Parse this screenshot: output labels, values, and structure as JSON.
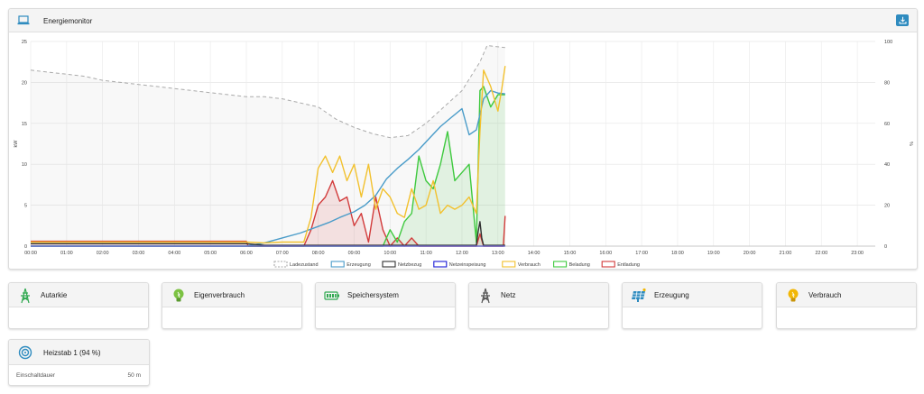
{
  "energy_card": {
    "title": "Energiemonitor",
    "title_icon": "laptop-icon",
    "action_icon": "download-icon"
  },
  "tiles": [
    {
      "name": "autarkie",
      "title": "Autarkie",
      "icon": "power-tower-icon",
      "icon_color": "#2fa84f"
    },
    {
      "name": "eigenverbrauch",
      "title": "Eigenverbrauch",
      "icon": "lightbulb-icon",
      "icon_color": "#7cc243"
    },
    {
      "name": "speichersystem",
      "title": "Speichersystem",
      "icon": "battery-icon",
      "icon_color": "#2fa84f"
    },
    {
      "name": "netz",
      "title": "Netz",
      "icon": "power-tower-icon",
      "icon_color": "#555555"
    },
    {
      "name": "erzeugung",
      "title": "Erzeugung",
      "icon": "solar-panel-icon",
      "icon_color": "#2e8bbf"
    },
    {
      "name": "verbrauch",
      "title": "Verbrauch",
      "icon": "lightbulb-icon",
      "icon_color": "#f2b705"
    }
  ],
  "heizstab": {
    "title": "Heizstab 1 (94 %)",
    "icon": "heater-icon",
    "row_label": "Einschaltdauer",
    "row_value": "50 m"
  },
  "chart_data": {
    "type": "line",
    "ylabel_left": "kW",
    "ylabel_right": "%",
    "ylim_left": [
      0,
      25
    ],
    "ylim_right": [
      0,
      100
    ],
    "y_ticks_left": [
      "0",
      "5",
      "10",
      "15",
      "20",
      "25"
    ],
    "y_ticks_right": [
      "0",
      "20",
      "40",
      "60",
      "80",
      "100"
    ],
    "x_ticks": [
      "00:00",
      "01:00",
      "02:00",
      "03:00",
      "04:00",
      "05:00",
      "06:00",
      "07:00",
      "08:00",
      "09:00",
      "10:00",
      "11:00",
      "12:00",
      "13:00",
      "14:00",
      "15:00",
      "16:00",
      "17:00",
      "18:00",
      "19:00",
      "20:00",
      "21:00",
      "22:00",
      "23:00"
    ],
    "xlim_hours": [
      0,
      23.5
    ],
    "grid": true,
    "legend_position": "bottom",
    "legend": [
      {
        "name": "Ladezustand",
        "color": "#aaaaaa",
        "dashed": true
      },
      {
        "name": "Erzeugung",
        "color": "#4a9cc9"
      },
      {
        "name": "Netzbezug",
        "color": "#333333"
      },
      {
        "name": "Netzeinspeisung",
        "color": "#1a1ad6"
      },
      {
        "name": "Verbrauch",
        "color": "#f2c12e"
      },
      {
        "name": "Beladung",
        "color": "#3ec93e"
      },
      {
        "name": "Entladung",
        "color": "#d23b3b"
      }
    ],
    "series": [
      {
        "name": "Ladezustand",
        "axis": "right",
        "color": "#aaaaaa",
        "dashed": true,
        "fill": true,
        "x": [
          0,
          0.5,
          1,
          1.5,
          2,
          2.5,
          3,
          3.5,
          4,
          4.5,
          5,
          5.5,
          6,
          6.5,
          7,
          7.5,
          8,
          8.5,
          9,
          9.5,
          10,
          10.5,
          11,
          11.5,
          12,
          12.5,
          12.7,
          13.2
        ],
        "y": [
          86,
          85,
          84,
          83,
          81,
          80,
          79,
          78,
          77,
          76,
          75,
          74,
          73,
          73,
          72,
          70,
          68,
          62,
          58,
          55,
          53,
          54,
          60,
          68,
          76,
          90,
          98,
          97
        ]
      },
      {
        "name": "Erzeugung",
        "axis": "left",
        "color": "#4a9cc9",
        "x": [
          0,
          6,
          6.5,
          7,
          7.5,
          8,
          8.3,
          8.6,
          9,
          9.3,
          9.6,
          9.9,
          10.2,
          10.5,
          10.8,
          11.1,
          11.4,
          11.7,
          12,
          12.2,
          12.4,
          12.6,
          12.8,
          13,
          13.2
        ],
        "y": [
          0,
          0,
          0.4,
          1,
          1.6,
          2.4,
          2.9,
          3.5,
          4.2,
          5,
          6.2,
          8.2,
          9.5,
          10.6,
          11.8,
          13.2,
          14.6,
          15.7,
          16.8,
          13.6,
          14.2,
          18,
          19,
          18.7,
          18.6
        ]
      },
      {
        "name": "Netzbezug",
        "axis": "left",
        "color": "#333333",
        "x": [
          0,
          6,
          6.5,
          12.4,
          12.45,
          12.5,
          12.55,
          12.6,
          13.2
        ],
        "y": [
          0.3,
          0.3,
          0.1,
          0.1,
          1.8,
          3,
          1,
          0.1,
          0.1
        ]
      },
      {
        "name": "Netzeinspeisung",
        "axis": "left",
        "color": "#1a1ad6",
        "x": [
          0,
          13.2
        ],
        "y": [
          0,
          0
        ]
      },
      {
        "name": "Verbrauch",
        "axis": "left",
        "color": "#f2c12e",
        "x": [
          0,
          6,
          6.5,
          7,
          7.6,
          7.8,
          8,
          8.2,
          8.4,
          8.6,
          8.8,
          9,
          9.2,
          9.4,
          9.6,
          9.8,
          10,
          10.2,
          10.4,
          10.6,
          10.8,
          11,
          11.2,
          11.4,
          11.6,
          11.8,
          12,
          12.2,
          12.4,
          12.5,
          12.6,
          12.8,
          13,
          13.1,
          13.2
        ],
        "y": [
          0.5,
          0.5,
          0.4,
          0.5,
          0.5,
          3.5,
          9.5,
          11,
          9,
          11,
          8,
          10,
          6,
          10,
          4.5,
          7,
          6,
          4,
          3.5,
          7,
          4.5,
          5,
          8,
          4,
          5,
          4.5,
          5,
          6,
          4,
          14,
          21.5,
          19.5,
          16.5,
          19,
          22
        ]
      },
      {
        "name": "Beladung",
        "axis": "left",
        "color": "#3ec93e",
        "fill": true,
        "x": [
          0,
          9.6,
          9.8,
          10,
          10.2,
          10.4,
          10.6,
          10.8,
          11,
          11.2,
          11.4,
          11.6,
          11.8,
          12,
          12.2,
          12.4,
          12.5,
          12.6,
          12.8,
          13,
          13.2
        ],
        "y": [
          0,
          0,
          0,
          2,
          0.5,
          3,
          4,
          11,
          8,
          7,
          10,
          14,
          8,
          9,
          10,
          0.5,
          19,
          19.5,
          17,
          18.5,
          18.5
        ]
      },
      {
        "name": "Entladung",
        "axis": "left",
        "color": "#d23b3b",
        "fill": true,
        "x": [
          0,
          6,
          6.05,
          7.6,
          7.8,
          8,
          8.2,
          8.4,
          8.6,
          8.8,
          9,
          9.2,
          9.4,
          9.6,
          9.8,
          10,
          10.2,
          10.4,
          10.6,
          10.8,
          11,
          12,
          12.4,
          12.5,
          12.6,
          13,
          13.15,
          13.2
        ],
        "y": [
          0.6,
          0.6,
          0,
          0,
          2,
          5,
          6,
          8,
          5.5,
          6,
          2.5,
          4,
          0.5,
          6,
          2,
          0,
          1,
          0,
          1,
          0,
          0,
          0,
          0,
          1.5,
          0,
          0,
          0,
          3.7
        ]
      }
    ]
  }
}
